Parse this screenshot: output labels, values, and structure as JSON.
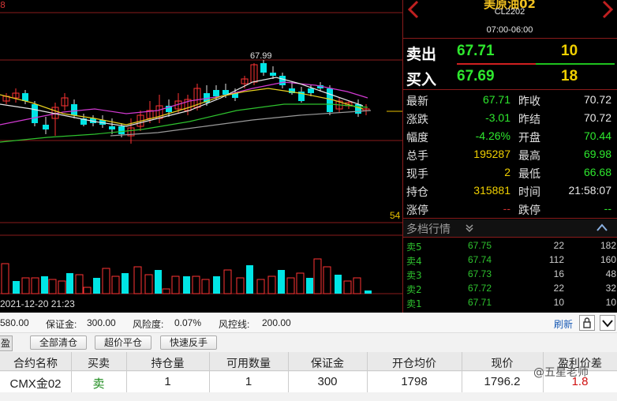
{
  "chart": {
    "top_left_num": "8",
    "peak_label": "67.99",
    "axis_label": "54",
    "date_label": "2021-12-20 21:23"
  },
  "quote": {
    "title": "美原油02",
    "code": "CL2202",
    "session": "07:00-06:00",
    "sell": {
      "label": "卖出",
      "price": "67.71",
      "volume": "10"
    },
    "buy": {
      "label": "买入",
      "price": "67.69",
      "volume": "18"
    },
    "stats": [
      {
        "l1": "最新",
        "v1": "67.71",
        "c1": "#2ee82e",
        "l2": "昨收",
        "v2": "70.72",
        "c2": "#e8e8e8"
      },
      {
        "l1": "涨跌",
        "v1": "-3.01",
        "c1": "#2ee82e",
        "l2": "昨结",
        "v2": "70.72",
        "c2": "#e8e8e8"
      },
      {
        "l1": "幅度",
        "v1": "-4.26%",
        "c1": "#2ee82e",
        "l2": "开盘",
        "v2": "70.44",
        "c2": "#2ee82e"
      },
      {
        "l1": "总手",
        "v1": "195287",
        "c1": "#f0d000",
        "l2": "最高",
        "v2": "69.98",
        "c2": "#2ee82e"
      },
      {
        "l1": "现手",
        "v1": "2",
        "c1": "#f0d000",
        "l2": "最低",
        "v2": "66.68",
        "c2": "#2ee82e"
      },
      {
        "l1": "持仓",
        "v1": "315881",
        "c1": "#f0d000",
        "l2": "时间",
        "v2": "21:58:07",
        "c2": "#e8e8e8"
      },
      {
        "l1": "涨停",
        "v1": "--",
        "c1": "#d03030",
        "l2": "跌停",
        "v2": "--",
        "c2": "#2ee82e"
      }
    ],
    "depth_title": "多档行情",
    "depth": [
      {
        "label": "卖5",
        "price": "67.75",
        "vol": "22",
        "vol2": "182"
      },
      {
        "label": "卖4",
        "price": "67.74",
        "vol": "112",
        "vol2": "160"
      },
      {
        "label": "卖3",
        "price": "67.73",
        "vol": "16",
        "vol2": "48"
      },
      {
        "label": "卖2",
        "price": "67.72",
        "vol": "22",
        "vol2": "32"
      },
      {
        "label": "卖1",
        "price": "67.71",
        "vol": "10",
        "vol2": "10"
      }
    ]
  },
  "account": {
    "balance": "580.00",
    "margin_label": "保证金:",
    "margin": "300.00",
    "risk_label": "风险度:",
    "risk": "0.07%",
    "control_label": "风控线:",
    "control": "200.00",
    "refresh": "刷新"
  },
  "buttons": {
    "side_tab": "盈",
    "close_all": "全部清仓",
    "super_close": "超价平仓",
    "reverse": "快速反手"
  },
  "positions": {
    "headers": [
      "合约名称",
      "买卖",
      "持仓量",
      "可用数量",
      "保证金",
      "开仓均价",
      "现价",
      "盈利价差"
    ],
    "rows": [
      {
        "name": "CMX金02",
        "side": "卖",
        "qty": "1",
        "avail": "1",
        "margin": "300",
        "open": "1798",
        "now": "1796.2",
        "pnl": "1.8"
      }
    ]
  },
  "watermark": "@五星老师",
  "colors": {
    "up": "#ff3333",
    "down": "#00e5e5",
    "green": "#2ee82e",
    "grid": "#8a1b1b"
  }
}
